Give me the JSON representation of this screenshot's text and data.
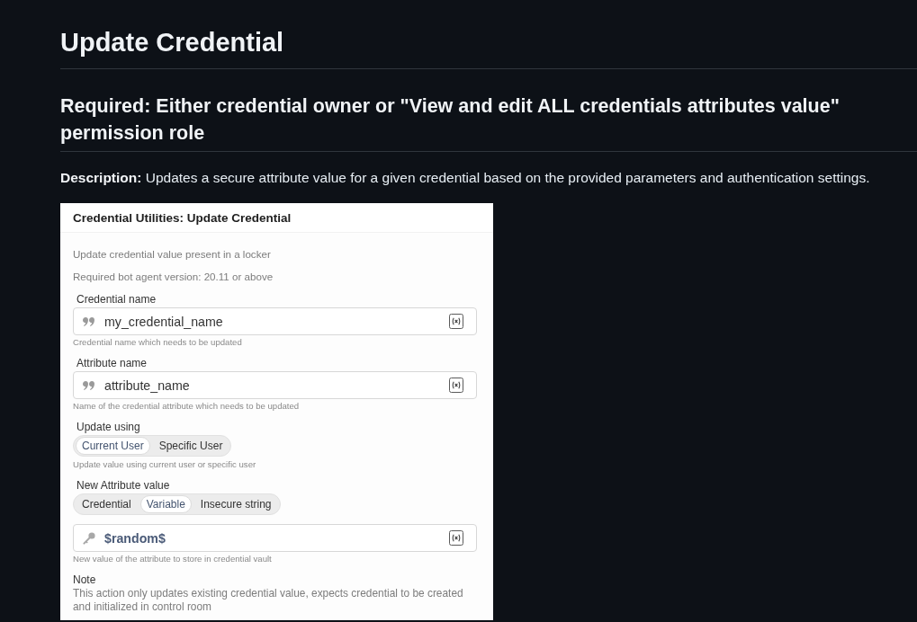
{
  "page": {
    "title": "Update Credential",
    "requirement": "Required: Either credential owner or \"View and edit ALL credentials attributes value\" permission role",
    "description": "**Description:** Updates a secure attribute value for a given credential based on the provided parameters and authentication settings."
  },
  "action_panel": {
    "title": "Credential Utilities: Update Credential",
    "summary": [
      "Update credential value present in a locker",
      "Required bot agent version: 20.11 or above"
    ],
    "fields": [
      {
        "kind": "text",
        "label": "Credential name",
        "value": "my_credential_name",
        "hint": "Credential name which needs to be updated"
      },
      {
        "kind": "text",
        "label": "Attribute name",
        "value": "attribute_name",
        "hint": "Name of the credential attribute which needs to be updated"
      },
      {
        "kind": "choice",
        "label": "Update using",
        "options": [
          {
            "label": "Current User",
            "selected": true
          },
          {
            "label": "Specific User",
            "selected": false
          }
        ],
        "hint": "Update value using current user or specific user"
      },
      {
        "kind": "choice",
        "label": "New Attribute value",
        "options": [
          {
            "label": "Credential",
            "selected": false
          },
          {
            "label": "Variable",
            "selected": true
          },
          {
            "label": "Insecure string",
            "selected": false
          }
        ]
      },
      {
        "kind": "variable",
        "value": "$random$",
        "hint": "New value of the attribute to store in credential vault"
      }
    ],
    "note": {
      "title": "Note",
      "text": "This action only updates existing credential value, expects credential to be created and initialized in control room"
    }
  }
}
